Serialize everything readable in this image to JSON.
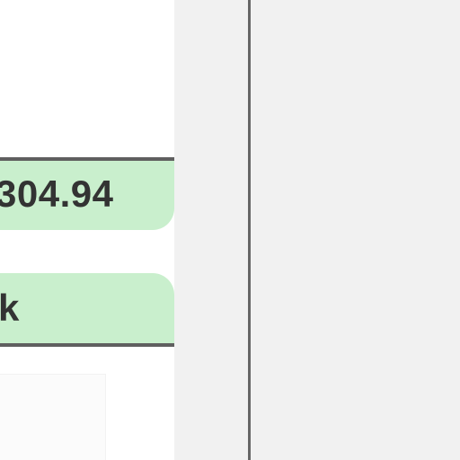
{
  "content": {
    "amount_value": "304.94",
    "partial_label": "k"
  },
  "colors": {
    "cell_green": "#c9efcd",
    "border_gray": "#5f5f5f",
    "text_dark": "#333333",
    "panel_gray": "#f1f1f1",
    "divider_gray": "#666666"
  }
}
